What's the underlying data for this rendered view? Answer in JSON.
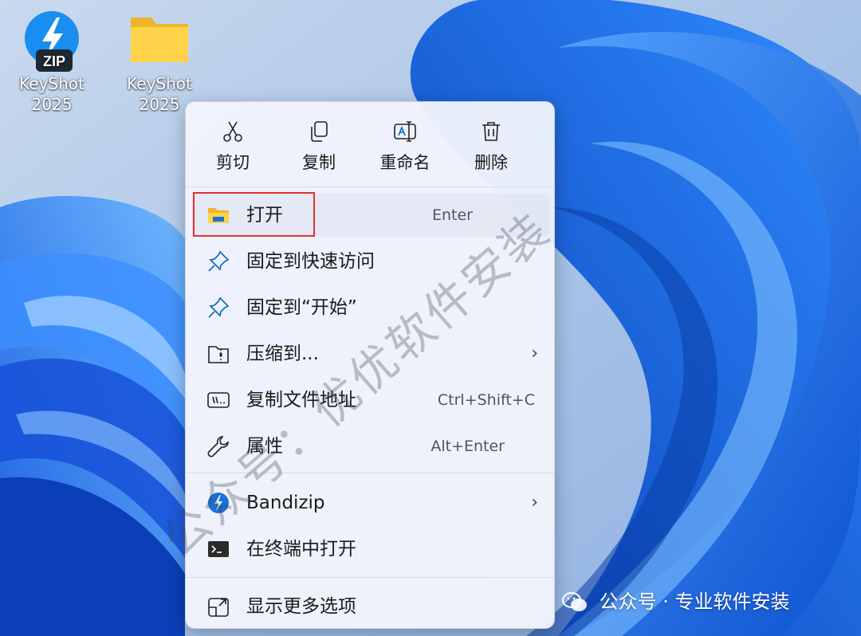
{
  "desktop": {
    "icons": [
      {
        "label_line1": "KeyShot",
        "label_line2": "2025",
        "badge": "ZIP",
        "icon": "bandizip-archive-icon"
      },
      {
        "label_line1": "KeyShot",
        "label_line2": "2025",
        "icon": "folder-icon"
      }
    ]
  },
  "context_menu": {
    "quick_actions": [
      {
        "label": "剪切",
        "icon": "scissors-icon"
      },
      {
        "label": "复制",
        "icon": "copy-icon"
      },
      {
        "label": "重命名",
        "icon": "rename-icon"
      },
      {
        "label": "删除",
        "icon": "trash-icon"
      }
    ],
    "items": [
      {
        "label": "打开",
        "shortcut": "Enter",
        "icon": "folder-open-icon",
        "highlighted": true
      },
      {
        "label": "固定到快速访问",
        "shortcut": "",
        "icon": "pin-icon"
      },
      {
        "label": "固定到“开始”",
        "shortcut": "",
        "icon": "pin-icon"
      },
      {
        "label": "压缩到...",
        "shortcut": "",
        "icon": "zip-folder-icon",
        "submenu": true
      },
      {
        "label": "复制文件地址",
        "shortcut": "Ctrl+Shift+C",
        "icon": "copy-path-icon"
      },
      {
        "label": "属性",
        "shortcut": "Alt+Enter",
        "icon": "wrench-icon"
      },
      {
        "label": "Bandizip",
        "shortcut": "",
        "icon": "bandizip-icon",
        "submenu": true
      },
      {
        "label": "在终端中打开",
        "shortcut": "",
        "icon": "terminal-icon"
      },
      {
        "label": "显示更多选项",
        "shortcut": "",
        "icon": "more-options-icon"
      }
    ],
    "submenu_glyph": "›"
  },
  "watermark": {
    "diagonal_text": "公众号：优优软件安装",
    "footer_text": "公众号 · 专业软件安装"
  },
  "colors": {
    "accent": "#0067c0",
    "highlight_border": "#e03030",
    "menu_bg": "#f1f4fc",
    "wallpaper_blue": "#1a6fe8"
  }
}
